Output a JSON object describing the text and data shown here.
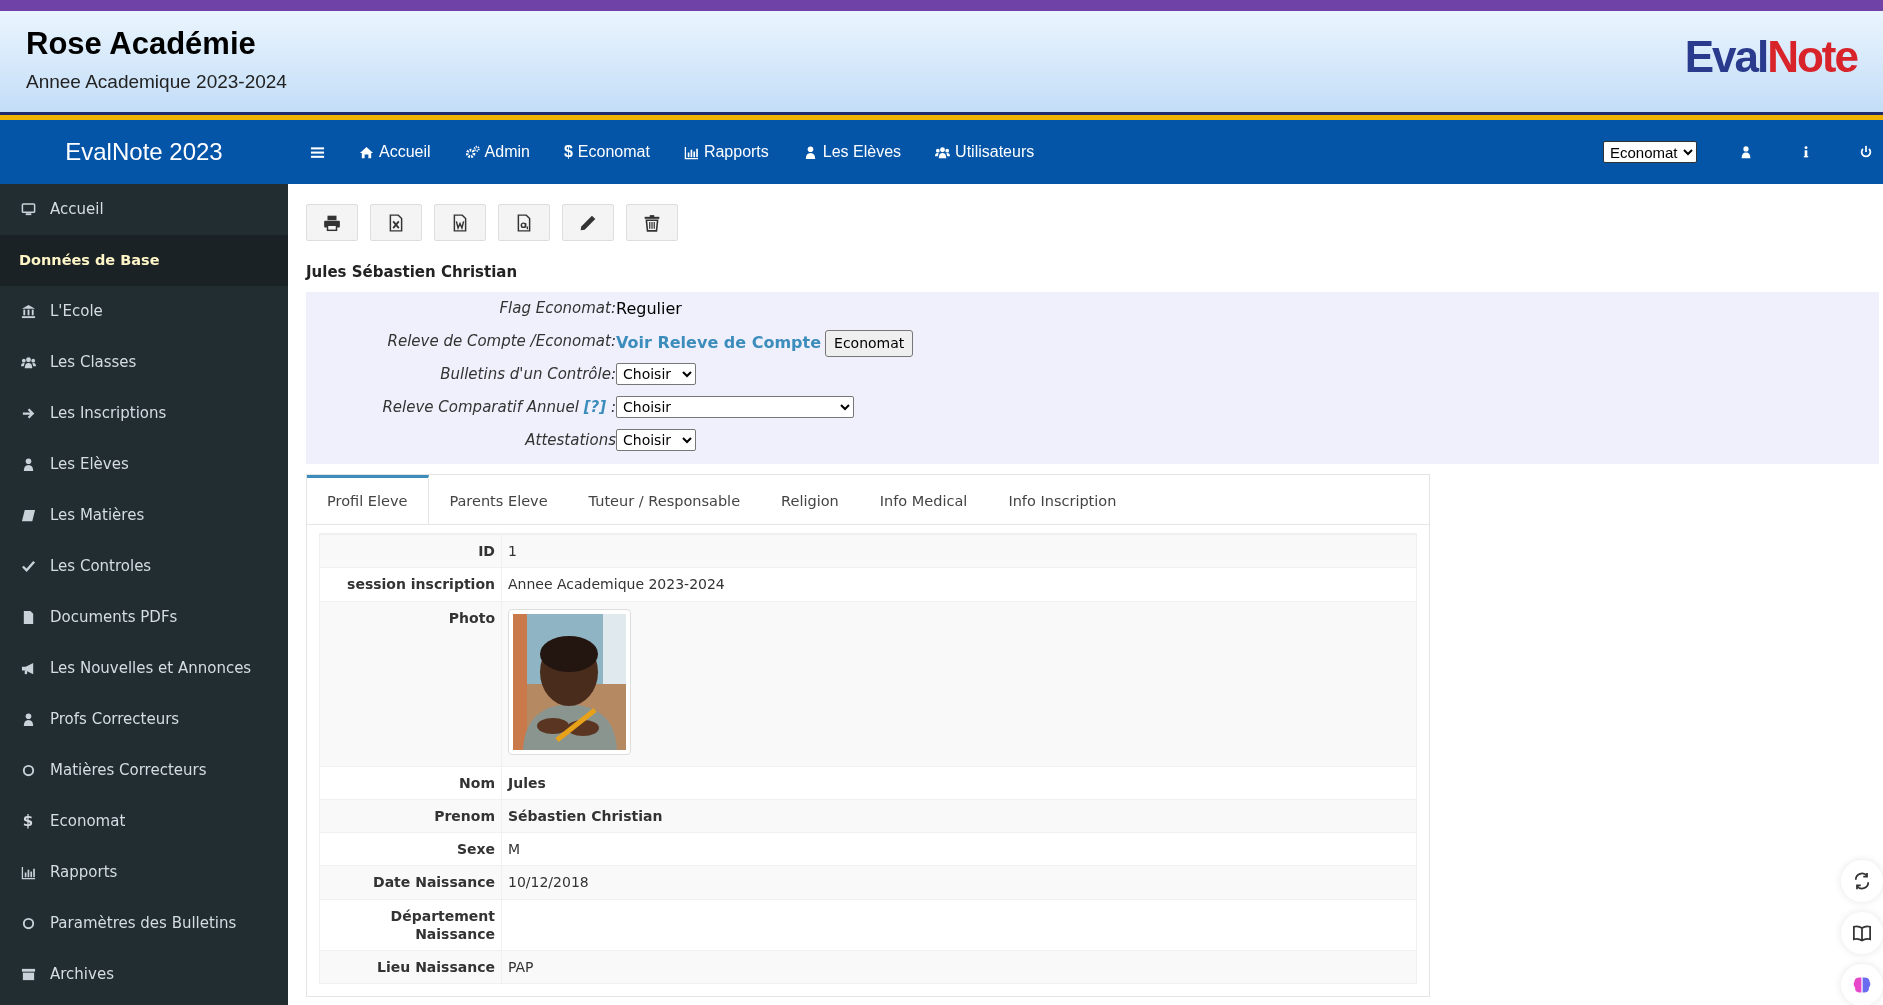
{
  "header": {
    "title": "Rose Académie",
    "subtitle": "Annee Academique 2023-2024",
    "logo": [
      "Eval",
      "Note"
    ]
  },
  "navbar": {
    "brand": "EvalNote 2023",
    "items": [
      {
        "label": "Accueil"
      },
      {
        "label": "Admin"
      },
      {
        "label": "Economat",
        "icon_text": "$"
      },
      {
        "label": "Rapports"
      },
      {
        "label": "Les Elèves"
      },
      {
        "label": "Utilisateurs"
      }
    ],
    "role_select": "Economat"
  },
  "sidebar": {
    "items": [
      {
        "kind": "item",
        "label": "Accueil"
      },
      {
        "kind": "header",
        "label": "Données de Base"
      },
      {
        "kind": "item",
        "label": "L'Ecole"
      },
      {
        "kind": "item",
        "label": "Les Classes"
      },
      {
        "kind": "item",
        "label": "Les Inscriptions"
      },
      {
        "kind": "item",
        "label": "Les Elèves"
      },
      {
        "kind": "item",
        "label": "Les Matières"
      },
      {
        "kind": "item",
        "label": "Les Controles"
      },
      {
        "kind": "item",
        "label": "Documents PDFs"
      },
      {
        "kind": "item",
        "label": "Les Nouvelles et Annonces"
      },
      {
        "kind": "item",
        "label": "Profs Correcteurs"
      },
      {
        "kind": "item",
        "label": "Matières Correcteurs"
      },
      {
        "kind": "item",
        "label": "Economat",
        "icon_text": "$"
      },
      {
        "kind": "item",
        "label": "Rapports"
      },
      {
        "kind": "item",
        "label": "Paramètres des Bulletins"
      },
      {
        "kind": "item",
        "label": "Archives"
      }
    ]
  },
  "student_name": "Jules Sébastien Christian",
  "actions": [
    {
      "kind": "text",
      "label": "Flag Economat:",
      "value": "Regulier"
    },
    {
      "kind": "link",
      "label": "Releve de Compte /Economat:",
      "link": "Voir Releve de Compte",
      "button": "Economat"
    },
    {
      "kind": "select",
      "label": "Bulletins d'un Contrôle:",
      "value": "Choisir",
      "wide": false
    },
    {
      "kind": "select",
      "label": "Releve Comparatif Annuel",
      "help": "[?]",
      "suffix": ":",
      "value": "Choisir",
      "wide": true
    },
    {
      "kind": "select",
      "label": "Attestations",
      "value": "Choisir",
      "wide": false
    }
  ],
  "tabs": [
    {
      "label": "Profil Eleve",
      "selected": true
    },
    {
      "label": "Parents Eleve",
      "selected": false
    },
    {
      "label": "Tuteur / Responsable",
      "selected": false
    },
    {
      "label": "Religion",
      "selected": false
    },
    {
      "label": "Info Medical",
      "selected": false
    },
    {
      "label": "Info Inscription",
      "selected": false
    }
  ],
  "profile": [
    {
      "kind": "text",
      "label": "ID",
      "value": "1",
      "emphasis": false
    },
    {
      "kind": "text",
      "label": "session inscription",
      "value": "Annee Academique 2023-2024",
      "emphasis": false
    },
    {
      "label": "Photo"
    },
    {
      "kind": "text",
      "label": "Nom",
      "value": "Jules",
      "emphasis": true
    },
    {
      "kind": "text",
      "label": "Prenom",
      "value": "Sébastien Christian",
      "emphasis": true
    },
    {
      "kind": "text",
      "label": "Sexe",
      "value": "M",
      "emphasis": false
    },
    {
      "kind": "text",
      "label": "Date Naissance",
      "value": "10/12/2018",
      "emphasis": false
    },
    {
      "kind": "text",
      "label": "Département Naissance"
    },
    {
      "kind": "text",
      "label": "Lieu Naissance",
      "value": "PAP",
      "emphasis": false
    }
  ]
}
